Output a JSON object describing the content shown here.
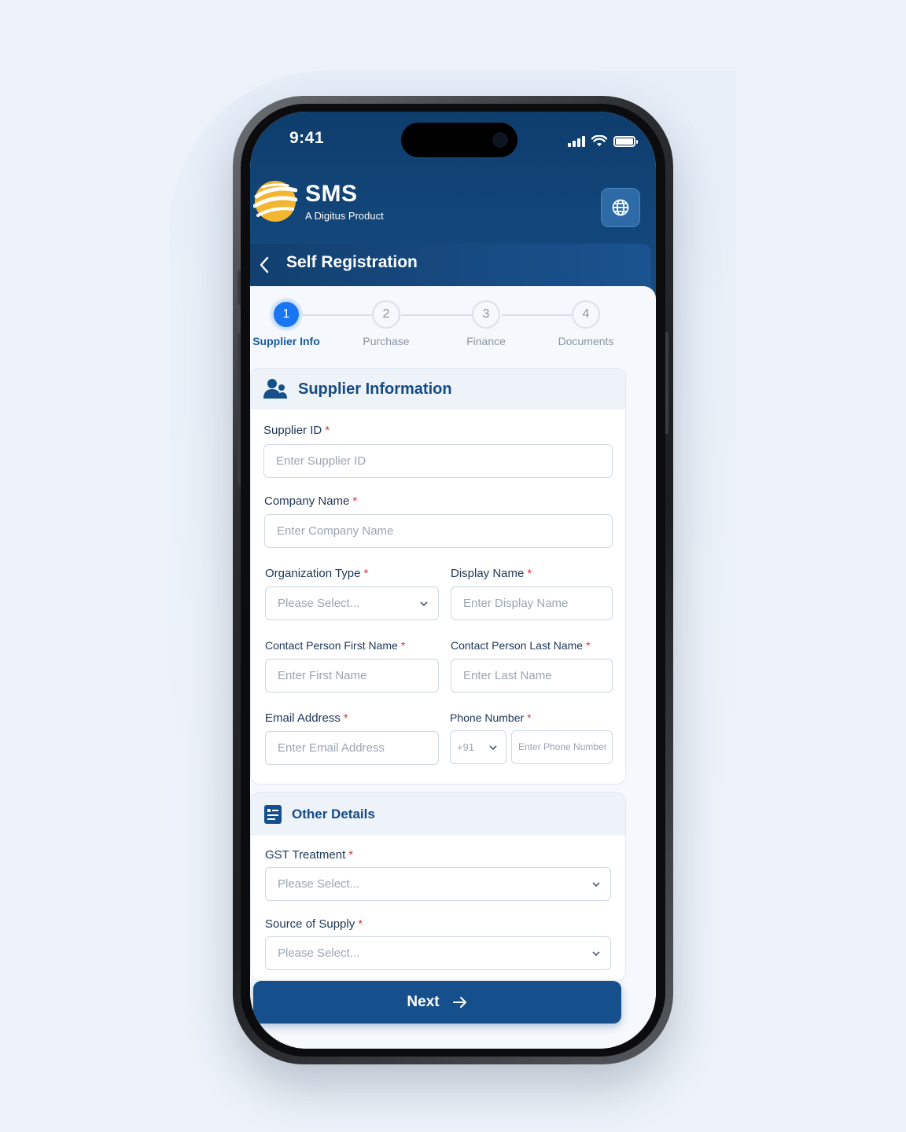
{
  "status": {
    "time": "9:41"
  },
  "brand": {
    "title": "SMS",
    "subtitle": "A Digitus Product"
  },
  "header": {
    "title": "Self Registration"
  },
  "stepper": {
    "active_step": 1,
    "steps": [
      {
        "number": "1",
        "label": "Supplier Info"
      },
      {
        "number": "2",
        "label": "Purchase"
      },
      {
        "number": "3",
        "label": "Finance"
      },
      {
        "number": "4",
        "label": "Documents"
      }
    ]
  },
  "supplier_section": {
    "title": "Supplier Information",
    "fields": {
      "supplier_id": {
        "label": "Supplier ID",
        "placeholder": "Enter Supplier ID"
      },
      "company_name": {
        "label": "Company Name",
        "placeholder": "Enter Company Name"
      },
      "organization_type": {
        "label": "Organization Type",
        "placeholder": "Please Select..."
      },
      "display_name": {
        "label": "Display Name",
        "placeholder": "Enter Display Name"
      },
      "first_name": {
        "label": "Contact Person First Name",
        "placeholder": "Enter First Name"
      },
      "last_name": {
        "label": "Contact Person Last Name",
        "placeholder": "Enter Last Name"
      },
      "email": {
        "label": "Email Address",
        "placeholder": "Enter Email Address"
      },
      "phone": {
        "label": "Phone Number",
        "country_code": "+91",
        "placeholder": "Enter Phone Number"
      }
    }
  },
  "other_section": {
    "title": "Other Details",
    "fields": {
      "gst_treatment": {
        "label": "GST Treatment",
        "placeholder": "Please Select..."
      },
      "source_of_supply": {
        "label": "Source of Supply",
        "placeholder": "Please Select..."
      }
    }
  },
  "required_marker": "*",
  "next_button": {
    "label": "Next"
  },
  "colors": {
    "primary": "#15508c",
    "accent": "#1976f2",
    "required": "#d93838",
    "logo": "#f2b630"
  }
}
